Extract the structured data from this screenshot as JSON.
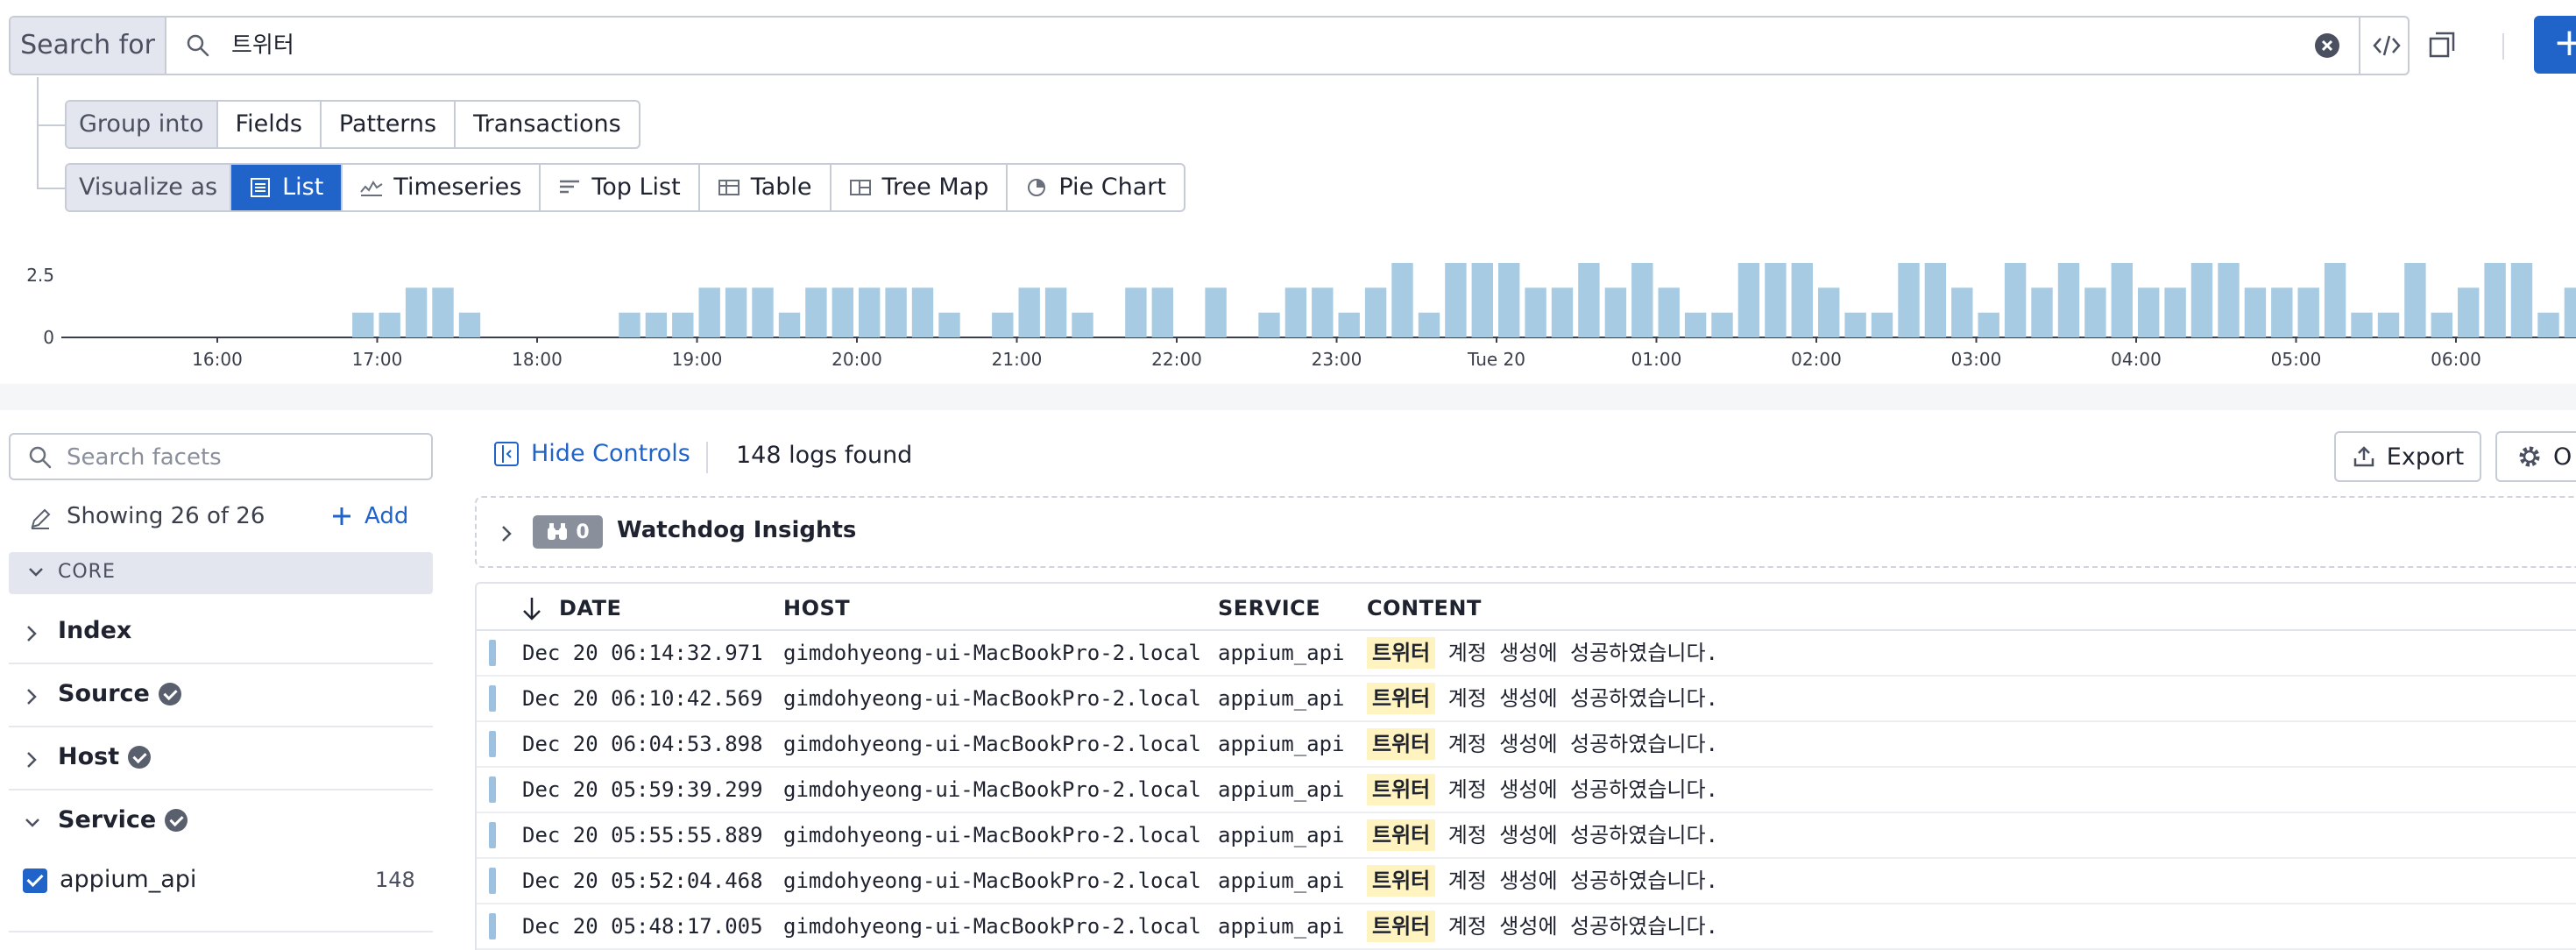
{
  "search": {
    "label": "Search for",
    "query": "트위터"
  },
  "group_into": {
    "label": "Group into",
    "options": [
      "Fields",
      "Patterns",
      "Transactions"
    ]
  },
  "visualize_as": {
    "label": "Visualize as",
    "options": [
      {
        "label": "List",
        "icon": "list-icon",
        "active": true
      },
      {
        "label": "Timeseries",
        "icon": "timeseries-icon",
        "active": false
      },
      {
        "label": "Top List",
        "icon": "top-list-icon",
        "active": false
      },
      {
        "label": "Table",
        "icon": "table-icon",
        "active": false
      },
      {
        "label": "Tree Map",
        "icon": "tree-map-icon",
        "active": false
      },
      {
        "label": "Pie Chart",
        "icon": "pie-chart-icon",
        "active": false
      }
    ]
  },
  "chart_data": {
    "type": "bar",
    "bar_color": "#a8cbe4",
    "y_ticks": [
      "0",
      "2.5"
    ],
    "ylim": [
      0,
      3
    ],
    "x_ticks": [
      "16:00",
      "17:00",
      "18:00",
      "19:00",
      "20:00",
      "21:00",
      "22:00",
      "23:00",
      "Tue 20",
      "01:00",
      "02:00",
      "03:00",
      "04:00",
      "05:00",
      "06:00"
    ],
    "x_start": "15:30",
    "bin_minutes": 10,
    "values": [
      0,
      0,
      0,
      0,
      0,
      0,
      0,
      0,
      1,
      1,
      2,
      2,
      1,
      0,
      0,
      0,
      0,
      0,
      1,
      1,
      1,
      2,
      2,
      2,
      1,
      2,
      2,
      2,
      2,
      2,
      1,
      0,
      1,
      2,
      2,
      1,
      0,
      2,
      2,
      0,
      2,
      0,
      1,
      2,
      2,
      1,
      2,
      3,
      1,
      3,
      3,
      3,
      2,
      2,
      3,
      2,
      3,
      2,
      1,
      1,
      3,
      3,
      3,
      2,
      1,
      1,
      3,
      3,
      2,
      1,
      3,
      2,
      3,
      2,
      3,
      2,
      2,
      3,
      3,
      2,
      2,
      2,
      3,
      1,
      1,
      3,
      1,
      2,
      3,
      3,
      1,
      2
    ]
  },
  "facets": {
    "search_placeholder": "Search facets",
    "showing": "Showing 26 of 26",
    "add_label": "Add",
    "core_label": "CORE",
    "groups": [
      {
        "label": "Index",
        "verified": false
      },
      {
        "label": "Source",
        "verified": true
      },
      {
        "label": "Host",
        "verified": true
      },
      {
        "label": "Service",
        "verified": true
      }
    ],
    "service_value": {
      "label": "appium_api",
      "count": "148"
    }
  },
  "controls": {
    "hide_label": "Hide Controls",
    "count_text": "148 logs found",
    "export_label": "Export",
    "options_label": "O"
  },
  "watchdog": {
    "count": "0",
    "label": "Watchdog Insights"
  },
  "table": {
    "columns": [
      "DATE",
      "HOST",
      "SERVICE",
      "CONTENT"
    ],
    "rows": [
      {
        "date": "Dec 20 06:14:32.971",
        "host": "gimdohyeong-ui-MacBookPro-2.local",
        "service": "appium_api",
        "highlight": "트위터",
        "content": "계정 생성에 성공하였습니다."
      },
      {
        "date": "Dec 20 06:10:42.569",
        "host": "gimdohyeong-ui-MacBookPro-2.local",
        "service": "appium_api",
        "highlight": "트위터",
        "content": "계정 생성에 성공하였습니다."
      },
      {
        "date": "Dec 20 06:04:53.898",
        "host": "gimdohyeong-ui-MacBookPro-2.local",
        "service": "appium_api",
        "highlight": "트위터",
        "content": "계정 생성에 성공하였습니다."
      },
      {
        "date": "Dec 20 05:59:39.299",
        "host": "gimdohyeong-ui-MacBookPro-2.local",
        "service": "appium_api",
        "highlight": "트위터",
        "content": "계정 생성에 성공하였습니다."
      },
      {
        "date": "Dec 20 05:55:55.889",
        "host": "gimdohyeong-ui-MacBookPro-2.local",
        "service": "appium_api",
        "highlight": "트위터",
        "content": "계정 생성에 성공하였습니다."
      },
      {
        "date": "Dec 20 05:52:04.468",
        "host": "gimdohyeong-ui-MacBookPro-2.local",
        "service": "appium_api",
        "highlight": "트위터",
        "content": "계정 생성에 성공하였습니다."
      },
      {
        "date": "Dec 20 05:48:17.005",
        "host": "gimdohyeong-ui-MacBookPro-2.local",
        "service": "appium_api",
        "highlight": "트위터",
        "content": "계정 생성에 성공하였습니다."
      }
    ]
  }
}
